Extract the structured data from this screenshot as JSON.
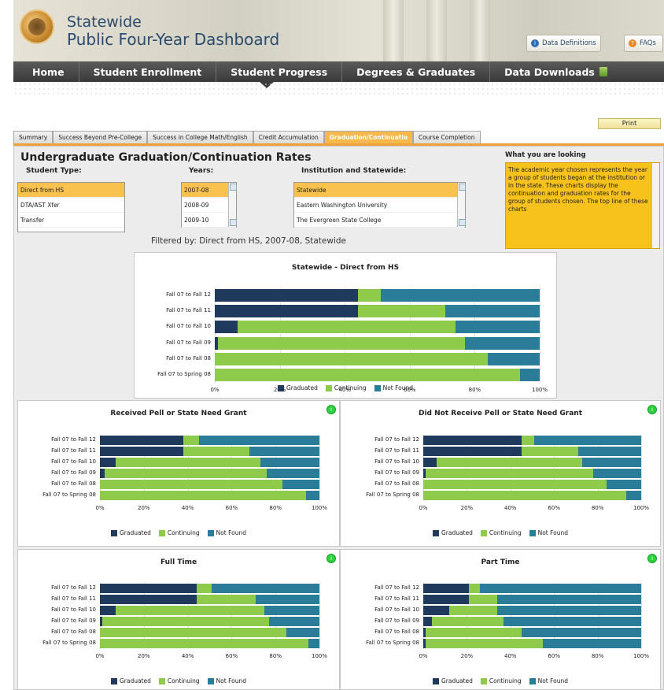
{
  "header": {
    "title_line1": "Statewide",
    "title_line2": "Public Four-Year Dashboard",
    "data_definitions": "Data Definitions",
    "faqs": "FAQs"
  },
  "nav": {
    "items": [
      "Home",
      "Student Enrollment",
      "Student Progress",
      "Degrees & Graduates",
      "Data Downloads"
    ]
  },
  "print_label": "Print",
  "tabs": [
    "Summary",
    "Success Beyond Pre-College",
    "Success in College Math/English",
    "Credit Accumulation",
    "Graduation/Continuatio",
    "Course Completion"
  ],
  "active_tab": 4,
  "page_title": "Undergraduate Graduation/Continuation Rates",
  "filters": {
    "student_type_label": "Student Type:",
    "student_types": [
      "Direct from HS",
      "DTA/AST Xfer",
      "Transfer"
    ],
    "years_label": "Years:",
    "years": [
      "2007-08",
      "2008-09",
      "2009-10"
    ],
    "institution_label": "Institution and Statewide:",
    "institutions": [
      "Statewide",
      "Eastern Washington University",
      "The Evergreen State College"
    ],
    "filtered_by": "Filtered by: Direct from HS, 2007-08, Statewide"
  },
  "info": {
    "title": "What you are looking",
    "text": "The academic year chosen represents the year a group of students began at the institution or in the state.  These charts display the continuation and graduation rates for the group of students chosen. The top line of these charts"
  },
  "colors": {
    "graduated": "#1f3a5c",
    "continuing": "#8fcb4a",
    "not_found": "#2b7c99",
    "accent": "#f7b84c"
  },
  "chart_data": [
    {
      "type": "bar",
      "title": "Statewide - Direct from HS",
      "orientation": "horizontal-stacked",
      "categories": [
        "Fall 07 to Fall 12",
        "Fall 07 to Fall 11",
        "Fall 07 to Fall 10",
        "Fall 07 to Fall 09",
        "Fall 07 to Fall 08",
        "Fall 07 to Spring 08"
      ],
      "series": [
        {
          "name": "Graduated",
          "values": [
            44,
            44,
            7,
            1,
            0,
            0
          ]
        },
        {
          "name": "Continuing",
          "values": [
            7,
            27,
            67,
            76,
            84,
            94
          ]
        },
        {
          "name": "Not Found",
          "values": [
            49,
            29,
            26,
            23,
            16,
            6
          ]
        }
      ],
      "x_ticks": [
        "0%",
        "20%",
        "40%",
        "60%",
        "80%",
        "100%"
      ]
    },
    {
      "type": "bar",
      "title": "Received Pell or State Need Grant",
      "orientation": "horizontal-stacked",
      "categories": [
        "Fall 07 to Fall 12",
        "Fall 07 to Fall 11",
        "Fall 07 to Fall 10",
        "Fall 07 to Fall 09",
        "Fall 07 to Fall 08",
        "Fall 07 to Spring 08"
      ],
      "series": [
        {
          "name": "Graduated",
          "values": [
            38,
            38,
            7,
            2,
            0,
            0
          ]
        },
        {
          "name": "Continuing",
          "values": [
            7,
            30,
            66,
            74,
            83,
            94
          ]
        },
        {
          "name": "Not Found",
          "values": [
            55,
            32,
            27,
            24,
            17,
            6
          ]
        }
      ],
      "x_ticks": [
        "0%",
        "20%",
        "40%",
        "60%",
        "80%",
        "100%"
      ]
    },
    {
      "type": "bar",
      "title": "Did Not Receive Pell or State Need Grant",
      "orientation": "horizontal-stacked",
      "categories": [
        "Fall 07 to Fall 12",
        "Fall 07 to Fall 11",
        "Fall 07 to Fall 10",
        "Fall 07 to Fall 09",
        "Fall 07 to Fall 08",
        "Fall 07 to Spring 08"
      ],
      "series": [
        {
          "name": "Graduated",
          "values": [
            45,
            45,
            6,
            1,
            0,
            0
          ]
        },
        {
          "name": "Continuing",
          "values": [
            6,
            26,
            67,
            77,
            84,
            93
          ]
        },
        {
          "name": "Not Found",
          "values": [
            49,
            29,
            27,
            22,
            16,
            7
          ]
        }
      ],
      "x_ticks": [
        "0%",
        "20%",
        "40%",
        "60%",
        "80%",
        "100%"
      ]
    },
    {
      "type": "bar",
      "title": "Full Time",
      "orientation": "horizontal-stacked",
      "categories": [
        "Fall 07 to Fall 12",
        "Fall 07 to Fall 11",
        "Fall 07 to Fall 10",
        "Fall 07 to Fall 09",
        "Fall 07 to Fall 08",
        "Fall 07 to Spring 08"
      ],
      "series": [
        {
          "name": "Graduated",
          "values": [
            44,
            44,
            7,
            1,
            0,
            0
          ]
        },
        {
          "name": "Continuing",
          "values": [
            7,
            27,
            68,
            76,
            85,
            95
          ]
        },
        {
          "name": "Not Found",
          "values": [
            49,
            29,
            25,
            23,
            15,
            5
          ]
        }
      ],
      "x_ticks": [
        "0%",
        "20%",
        "40%",
        "60%",
        "80%",
        "100%"
      ]
    },
    {
      "type": "bar",
      "title": "Part Time",
      "orientation": "horizontal-stacked",
      "categories": [
        "Fall 07 to Fall 12",
        "Fall 07 to Fall 11",
        "Fall 07 to Fall 10",
        "Fall 07 to Fall 09",
        "Fall 07 to Fall 08",
        "Fall 07 to Spring 08"
      ],
      "series": [
        {
          "name": "Graduated",
          "values": [
            21,
            21,
            12,
            4,
            1,
            1
          ]
        },
        {
          "name": "Continuing",
          "values": [
            5,
            13,
            22,
            33,
            44,
            54
          ]
        },
        {
          "name": "Not Found",
          "values": [
            74,
            66,
            66,
            63,
            55,
            45
          ]
        }
      ],
      "x_ticks": [
        "0%",
        "20%",
        "40%",
        "60%",
        "80%",
        "100%"
      ]
    }
  ]
}
